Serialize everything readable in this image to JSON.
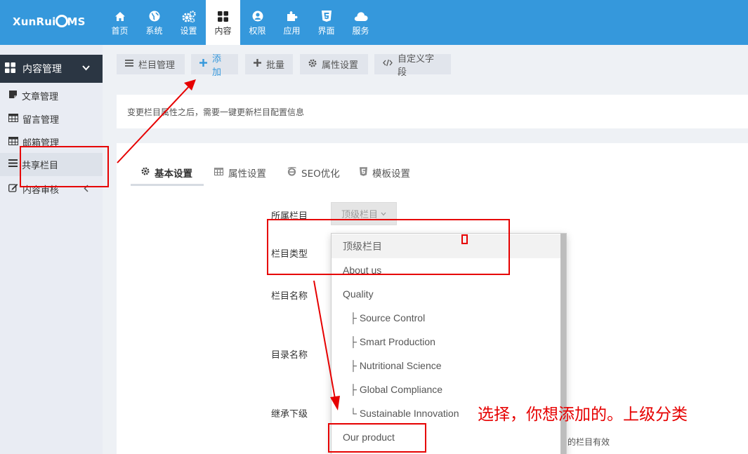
{
  "app": {
    "logo": {
      "prefix": "XunRui",
      "suffix": "MS"
    }
  },
  "nav": [
    {
      "label": "首页",
      "icon": "home-icon",
      "active": false
    },
    {
      "label": "系统",
      "icon": "globe-icon",
      "active": false
    },
    {
      "label": "设置",
      "icon": "cogs-icon",
      "active": false
    },
    {
      "label": "内容",
      "icon": "grid-icon",
      "active": true
    },
    {
      "label": "权限",
      "icon": "user-icon",
      "active": false
    },
    {
      "label": "应用",
      "icon": "puzzle-icon",
      "active": false
    },
    {
      "label": "界面",
      "icon": "html5-icon",
      "active": false
    },
    {
      "label": "服务",
      "icon": "cloud-icon",
      "active": false
    }
  ],
  "sidebar": {
    "header": "内容管理",
    "items": [
      {
        "label": "文章管理",
        "icon": "note-icon"
      },
      {
        "label": "留言管理",
        "icon": "table-icon"
      },
      {
        "label": "邮箱管理",
        "icon": "table-icon"
      },
      {
        "label": "共享栏目",
        "icon": "list-icon"
      },
      {
        "label": "内容审核",
        "icon": "edit-icon"
      }
    ]
  },
  "toolbar": {
    "category_manage": "栏目管理",
    "add": "添加",
    "batch": "批量",
    "attr_settings": "属性设置",
    "custom_fields": "自定义字段"
  },
  "notice": "变更栏目属性之后，需要一键更新栏目配置信息",
  "tabs": [
    {
      "label": "基本设置",
      "icon": "gear-icon",
      "active": true
    },
    {
      "label": "属性设置",
      "icon": "table-icon",
      "active": false
    },
    {
      "label": "SEO优化",
      "icon": "ie-icon",
      "active": false
    },
    {
      "label": "模板设置",
      "icon": "html5-icon",
      "active": false
    }
  ],
  "form": {
    "parent_label": "所属栏目",
    "type_label": "栏目类型",
    "name_label": "栏目名称",
    "dir_label": "目录名称",
    "inherit_label": "继承下级",
    "parent_select_value": "顶级栏目",
    "inherit_hint": "的栏目有效"
  },
  "dropdown_options": [
    {
      "label": "顶级栏目",
      "selected": true,
      "prefix": ""
    },
    {
      "label": "About us",
      "selected": false,
      "prefix": ""
    },
    {
      "label": "Quality",
      "selected": false,
      "prefix": ""
    },
    {
      "label": "Source Control",
      "selected": false,
      "prefix": "├ "
    },
    {
      "label": "Smart Production",
      "selected": false,
      "prefix": "├ "
    },
    {
      "label": "Nutritional Science",
      "selected": false,
      "prefix": "├ "
    },
    {
      "label": "Global Compliance",
      "selected": false,
      "prefix": "├ "
    },
    {
      "label": "Sustainable Innovation",
      "selected": false,
      "prefix": "└ "
    },
    {
      "label": "Our product",
      "selected": false,
      "prefix": ""
    }
  ],
  "annotation": {
    "text": "选择，你想添加的。上级分类",
    "color": "#e60000"
  },
  "colors": {
    "topbar": "#3598dc",
    "sidebar_header": "#2b3643",
    "accent": "#3598dc"
  }
}
